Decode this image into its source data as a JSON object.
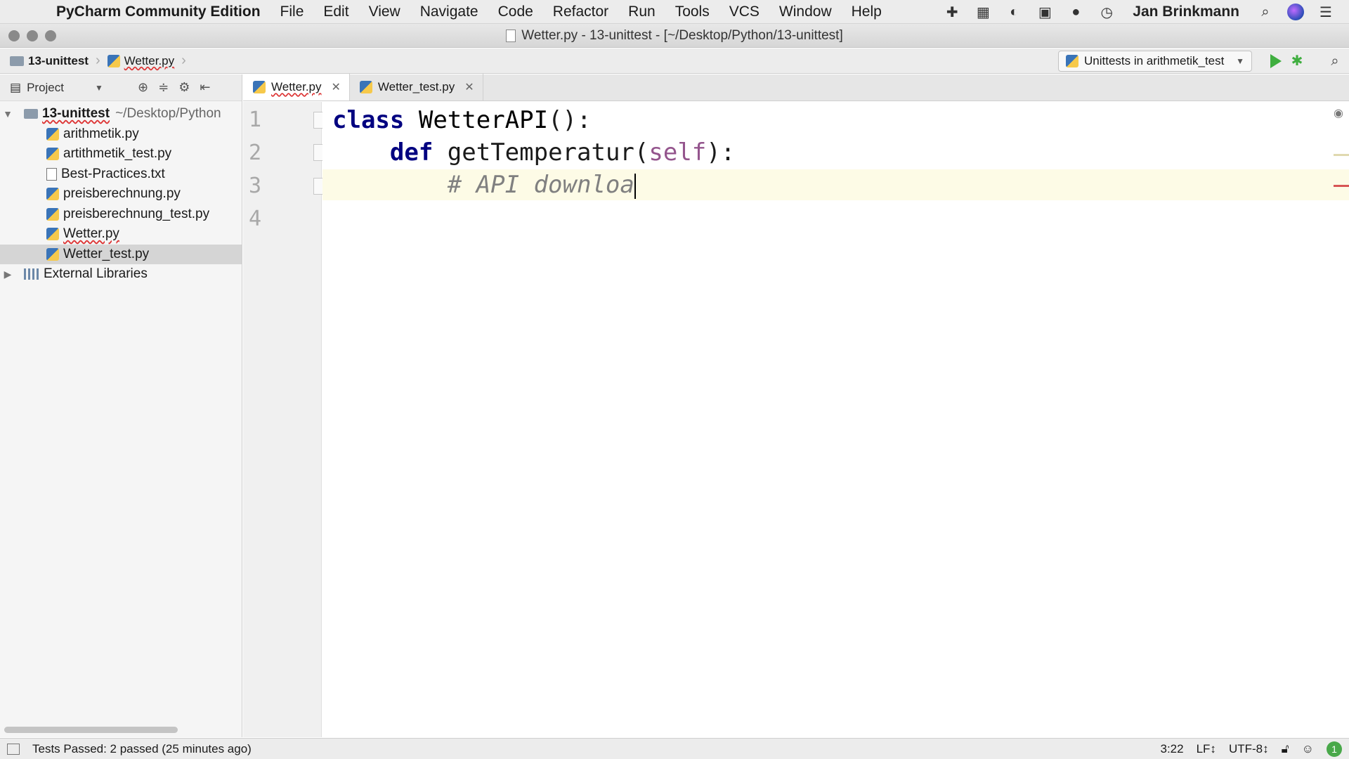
{
  "menubar": {
    "app_name": "PyCharm Community Edition",
    "items": [
      "File",
      "Edit",
      "View",
      "Navigate",
      "Code",
      "Refactor",
      "Run",
      "Tools",
      "VCS",
      "Window",
      "Help"
    ],
    "user": "Jan Brinkmann"
  },
  "window": {
    "title": "Wetter.py - 13-unittest - [~/Desktop/Python/13-unittest]"
  },
  "navbar": {
    "breadcrumb_project": "13-unittest",
    "breadcrumb_file": "Wetter.py",
    "run_config": "Unittests in arithmetik_test"
  },
  "project_panel": {
    "header": "Project",
    "root_name": "13-unittest",
    "root_path": "~/Desktop/Python",
    "files": [
      "arithmetik.py",
      "artithmetik_test.py",
      "Best-Practices.txt",
      "preisberechnung.py",
      "preisberechnung_test.py",
      "Wetter.py",
      "Wetter_test.py"
    ],
    "external": "External Libraries"
  },
  "editor": {
    "tabs": [
      "Wetter.py",
      "Wetter_test.py"
    ],
    "line_numbers": [
      "1",
      "2",
      "3",
      "4"
    ],
    "line1_kw": "class",
    "line1_name": "WetterAPI",
    "line1_rest": "():",
    "line2_indent": "    ",
    "line2_kw": "def",
    "line2_name": "getTemperatur",
    "line2_open": "(",
    "line2_param": "self",
    "line2_close": "):",
    "line3_indent": "        ",
    "line3_comment": "# API downloa"
  },
  "status": {
    "message": "Tests Passed: 2 passed (25 minutes ago)",
    "position": "3:22",
    "line_sep": "LF↕",
    "encoding": "UTF-8↕",
    "notifications": "1"
  }
}
